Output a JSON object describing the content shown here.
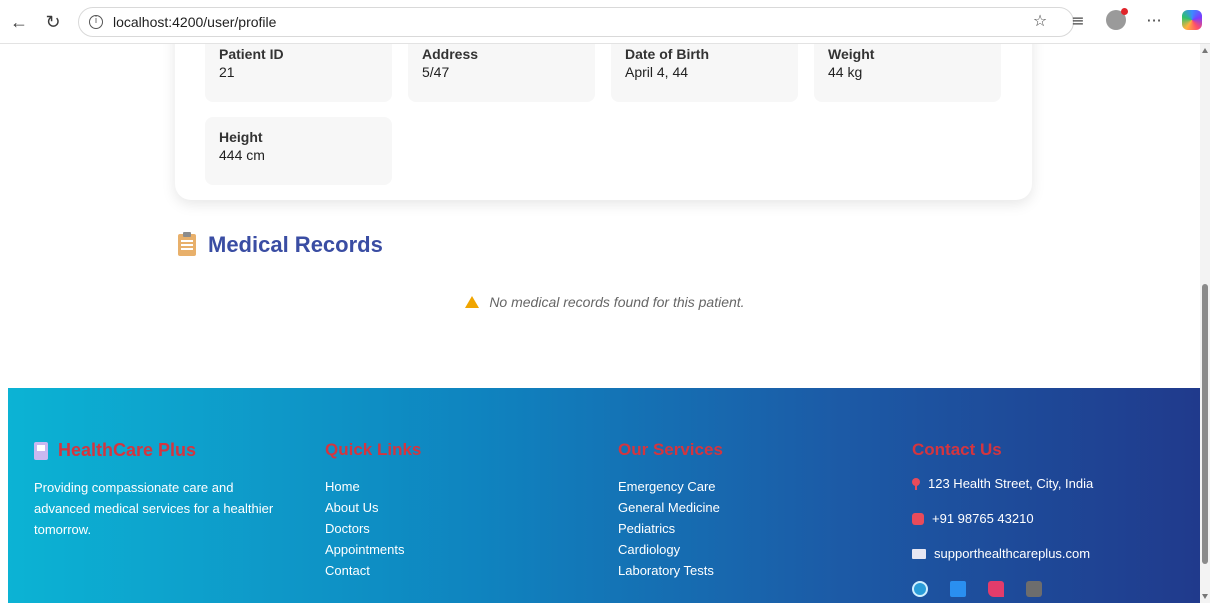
{
  "browser": {
    "url": "localhost:4200/user/profile",
    "more_label": "···"
  },
  "profile": {
    "fields": [
      {
        "label": "Patient ID",
        "value": "21"
      },
      {
        "label": "Address",
        "value": "5/47"
      },
      {
        "label": "Date of Birth",
        "value": "April 4, 44"
      },
      {
        "label": "Weight",
        "value": "44 kg"
      },
      {
        "label": "Height",
        "value": "444 cm"
      }
    ]
  },
  "records": {
    "title": "Medical Records",
    "empty_message": "No medical records found for this patient."
  },
  "footer": {
    "brand": {
      "name": "HealthCare Plus",
      "tagline": "Providing compassionate care and advanced medical services for a healthier tomorrow."
    },
    "quick_links": {
      "heading": "Quick Links",
      "items": [
        "Home",
        "About Us",
        "Doctors",
        "Appointments",
        "Contact"
      ]
    },
    "services": {
      "heading": "Our Services",
      "items": [
        "Emergency Care",
        "General Medicine",
        "Pediatrics",
        "Cardiology",
        "Laboratory Tests"
      ]
    },
    "contact": {
      "heading": "Contact Us",
      "address": "123 Health Street, City, India",
      "phone": "+91 98765 43210",
      "email": "supporthealthcareplus.com"
    },
    "social_icons": [
      "globe-icon",
      "book-icon",
      "boot-icon",
      "camera-icon"
    ]
  },
  "colors": {
    "accent_heading": "#d4353f",
    "records_title": "#3a4da3",
    "footer_gradient_start": "#0cb3d4",
    "footer_gradient_end": "#203a8c"
  }
}
